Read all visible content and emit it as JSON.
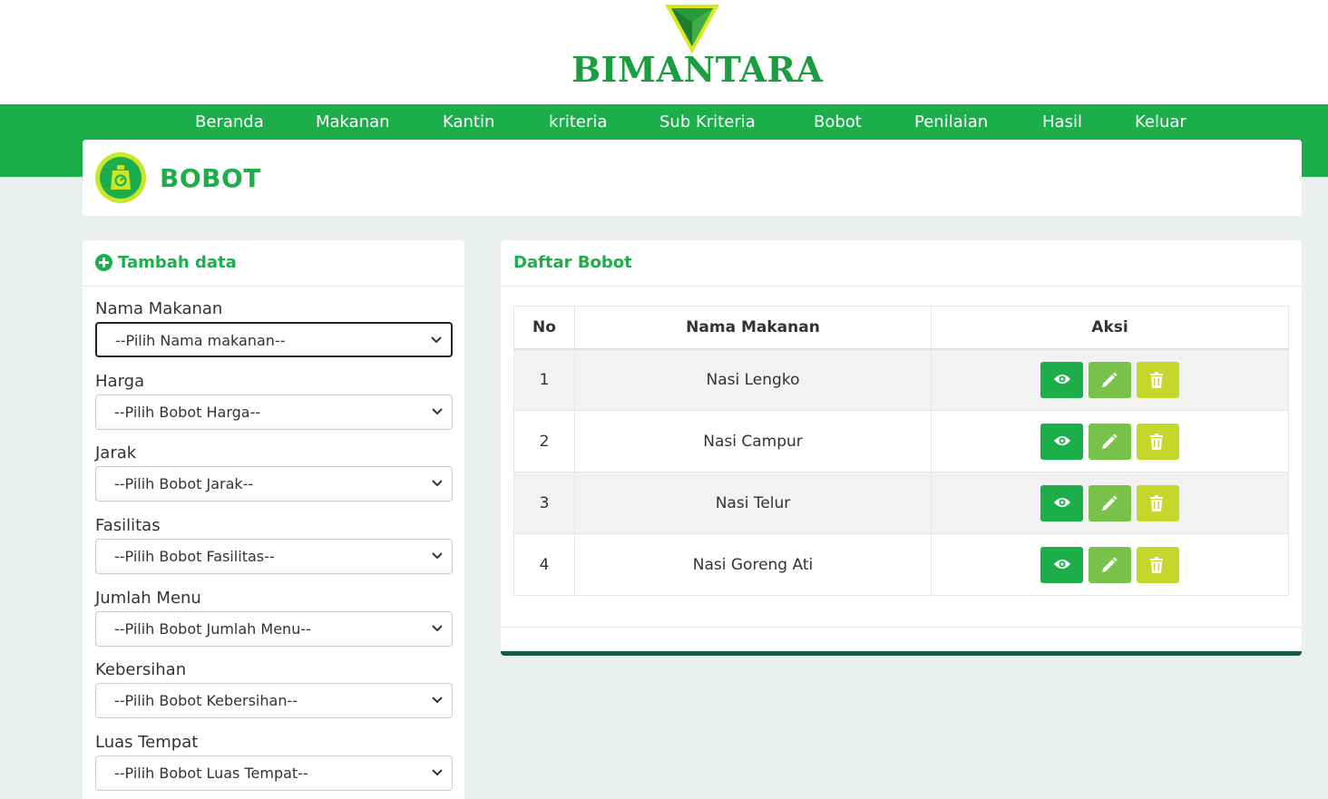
{
  "brand": {
    "name": "BIMANTARA"
  },
  "nav": {
    "items": [
      {
        "label": "Beranda"
      },
      {
        "label": "Makanan"
      },
      {
        "label": "Kantin"
      },
      {
        "label": "kriteria"
      },
      {
        "label": "Sub Kriteria"
      },
      {
        "label": "Bobot"
      },
      {
        "label": "Penilaian"
      },
      {
        "label": "Hasil"
      },
      {
        "label": "Keluar"
      }
    ]
  },
  "page": {
    "title": "BOBOT",
    "icon": "scale-icon"
  },
  "form": {
    "title": "Tambah data",
    "fields": [
      {
        "label": "Nama Makanan",
        "placeholder": "--Pilih Nama makanan--"
      },
      {
        "label": "Harga",
        "placeholder": "--Pilih Bobot Harga--"
      },
      {
        "label": "Jarak",
        "placeholder": "--Pilih Bobot Jarak--"
      },
      {
        "label": "Fasilitas",
        "placeholder": "--Pilih Bobot Fasilitas--"
      },
      {
        "label": "Jumlah Menu",
        "placeholder": "--Pilih Bobot Jumlah Menu--"
      },
      {
        "label": "Kebersihan",
        "placeholder": "--Pilih Bobot Kebersihan--"
      },
      {
        "label": "Luas Tempat",
        "placeholder": "--Pilih Bobot Luas Tempat--"
      }
    ]
  },
  "list": {
    "title": "Daftar Bobot",
    "columns": [
      "No",
      "Nama Makanan",
      "Aksi"
    ],
    "rows": [
      {
        "no": "1",
        "name": "Nasi Lengko"
      },
      {
        "no": "2",
        "name": "Nasi Campur"
      },
      {
        "no": "3",
        "name": "Nasi Telur"
      },
      {
        "no": "4",
        "name": "Nasi Goreng Ati"
      }
    ],
    "actions": [
      "eye-icon",
      "pencil-icon",
      "trash-icon"
    ]
  },
  "colors": {
    "primary": "#1cae4a",
    "edit": "#79c24a",
    "delete": "#c6d72b",
    "footer_bar": "#145a45"
  }
}
